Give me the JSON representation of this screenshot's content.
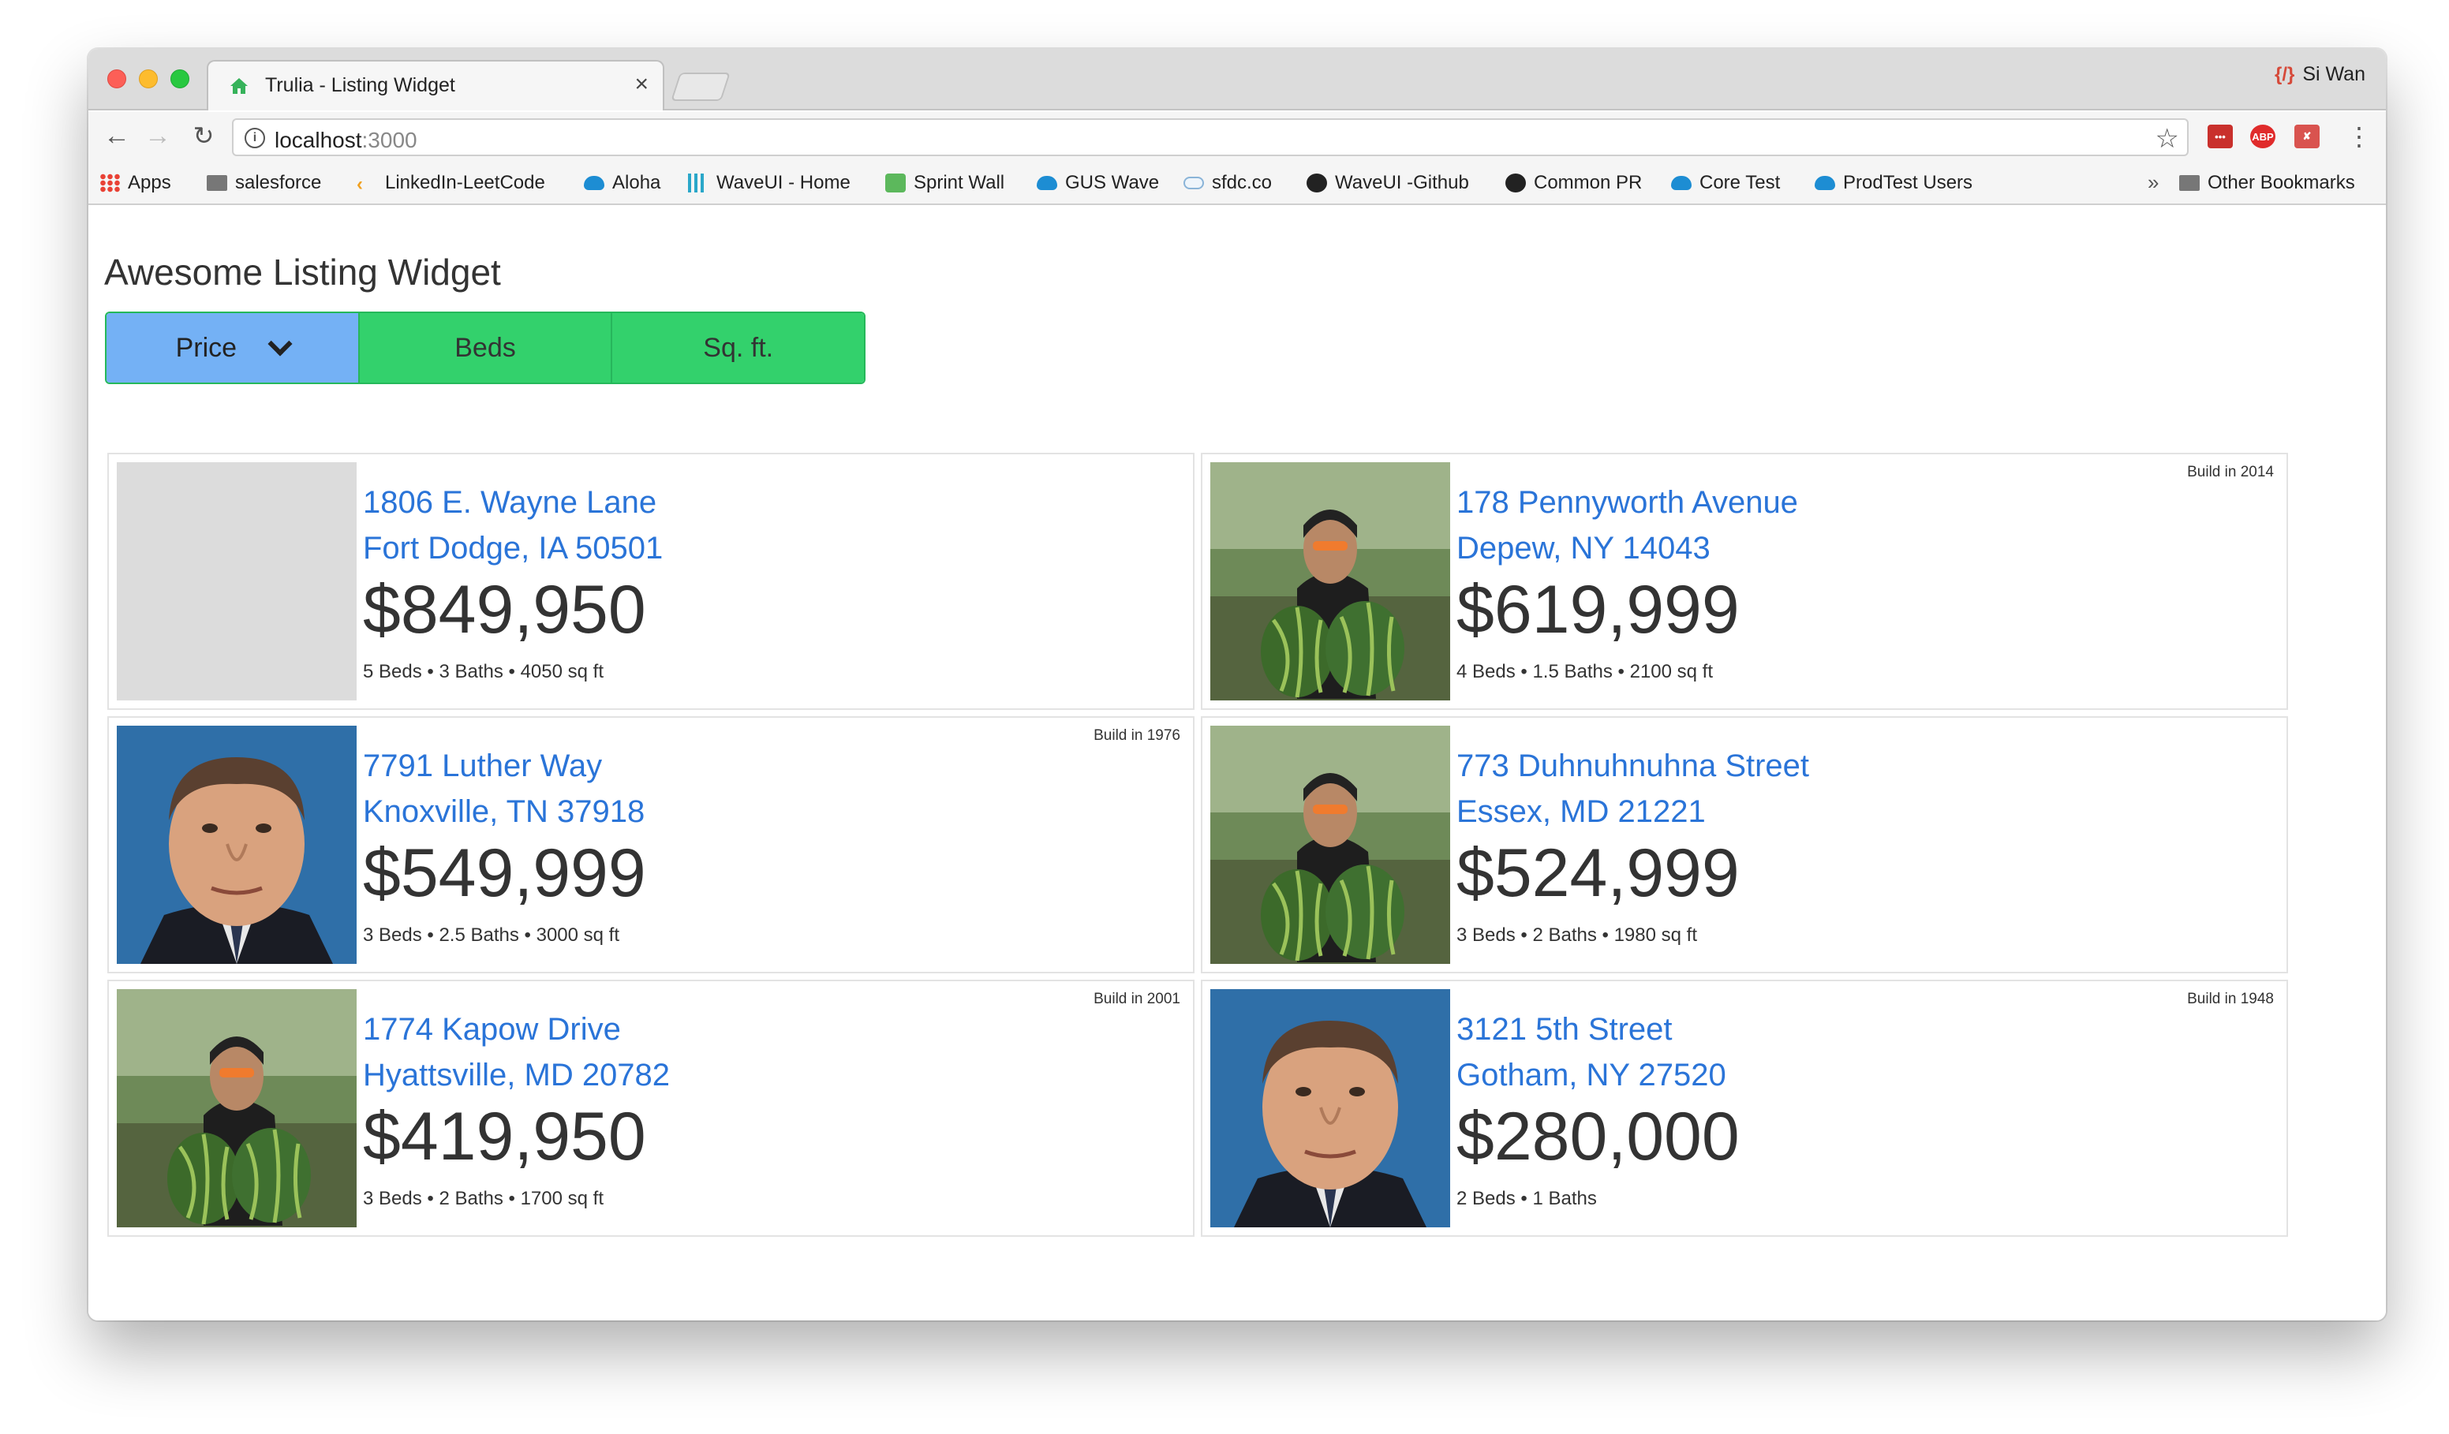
{
  "browser": {
    "tab_title": "Trulia - Listing Widget",
    "tab_close": "×",
    "profile_name": "Si Wan",
    "url_host": "localhost",
    "url_port": ":3000",
    "bookmarks": [
      {
        "label": "Apps",
        "icon": "apps-grid-icon"
      },
      {
        "label": "salesforce",
        "icon": "folder-icon"
      },
      {
        "label": "LinkedIn-LeetCode",
        "icon": "leetcode-icon"
      },
      {
        "label": "Aloha",
        "icon": "salesforce-cloud-icon"
      },
      {
        "label": "WaveUI - Home",
        "icon": "bar-chart-icon"
      },
      {
        "label": "Sprint Wall",
        "icon": "green-app-icon"
      },
      {
        "label": "GUS Wave",
        "icon": "salesforce-cloud-icon"
      },
      {
        "label": "sfdc.co",
        "icon": "cloud-outline-icon"
      },
      {
        "label": "WaveUI -Github",
        "icon": "github-icon"
      },
      {
        "label": "Common PR",
        "icon": "github-icon"
      },
      {
        "label": "Core Test",
        "icon": "salesforce-cloud-icon"
      },
      {
        "label": "ProdTest Users",
        "icon": "salesforce-cloud-icon"
      }
    ],
    "bookmarks_more": "»",
    "other_bookmarks": "Other Bookmarks",
    "extensions": [
      "ABP"
    ]
  },
  "page": {
    "title": "Awesome Listing Widget",
    "sort_options": [
      {
        "label": "Price",
        "active": true
      },
      {
        "label": "Beds",
        "active": false
      },
      {
        "label": "Sq. ft.",
        "active": false
      }
    ],
    "listings": [
      {
        "street": "1806 E. Wayne Lane",
        "city": "Fort Dodge, IA 50501",
        "price": "$849,950",
        "details": "5 Beds • 3 Baths • 4050 sq ft",
        "build": "",
        "image": "placeholder"
      },
      {
        "street": "178 Pennyworth Avenue",
        "city": "Depew, NY 14043",
        "price": "$619,999",
        "details": "4 Beds • 1.5 Baths • 2100 sq ft",
        "build": "Build in 2014",
        "image": "man-with-watermelons"
      },
      {
        "street": "7791 Luther Way",
        "city": "Knoxville, TN 37918",
        "price": "$549,999",
        "details": "3 Beds • 2.5 Baths • 3000 sq ft",
        "build": "Build in 1976",
        "image": "man-portrait"
      },
      {
        "street": "773 Duhnuhnuhna Street",
        "city": "Essex, MD 21221",
        "price": "$524,999",
        "details": "3 Beds • 2 Baths • 1980 sq ft",
        "build": "",
        "image": "man-with-watermelons"
      },
      {
        "street": "1774 Kapow Drive",
        "city": "Hyattsville, MD 20782",
        "price": "$419,950",
        "details": "3 Beds • 2 Baths • 1700 sq ft",
        "build": "Build in 2001",
        "image": "man-with-watermelons"
      },
      {
        "street": "3121 5th Street",
        "city": "Gotham, NY 27520",
        "price": "$280,000",
        "details": "2 Beds • 1 Baths",
        "build": "Build in 1948",
        "image": "man-portrait"
      }
    ]
  },
  "colors": {
    "link": "#2a74d8",
    "sort_active": "#74b1f5",
    "sort_inactive": "#33d16c"
  }
}
